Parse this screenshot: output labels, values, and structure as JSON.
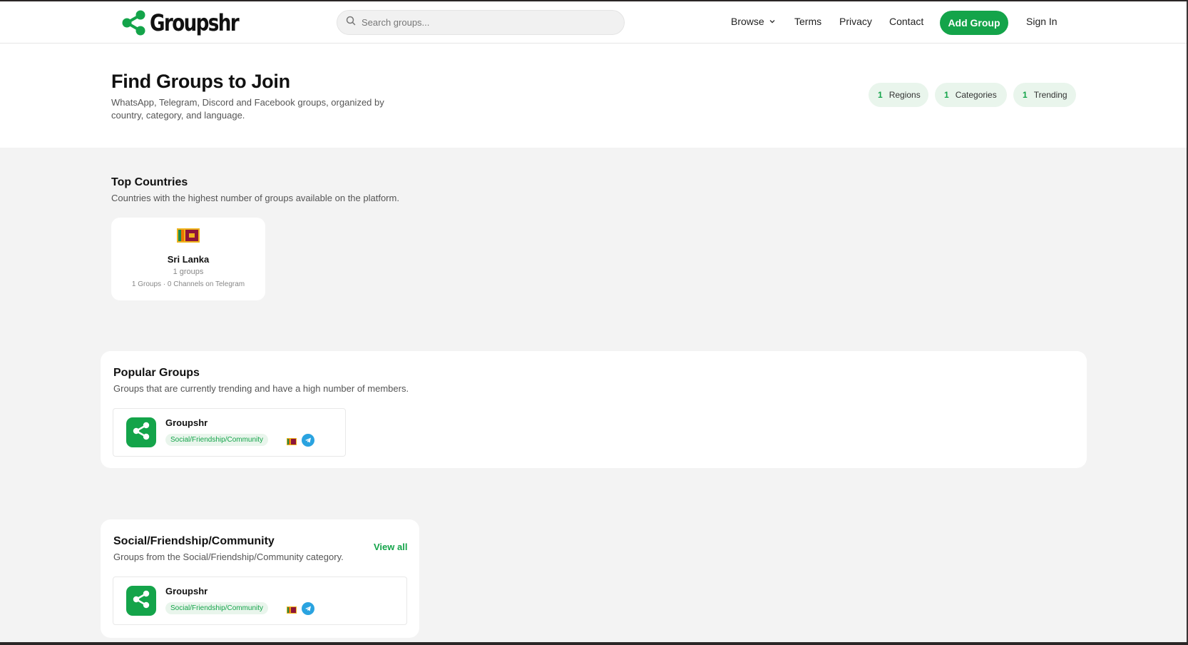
{
  "header": {
    "brand": "Groupshr",
    "search_placeholder": "Search groups...",
    "nav": {
      "browse": "Browse",
      "terms": "Terms",
      "privacy": "Privacy",
      "contact": "Contact",
      "add_group": "Add Group",
      "sign_in": "Sign In"
    }
  },
  "hero": {
    "title": "Find Groups to Join",
    "subtitle": "WhatsApp, Telegram, Discord and Facebook groups, organized by country, category, and language.",
    "stats": [
      {
        "num": "1",
        "label": "Regions"
      },
      {
        "num": "1",
        "label": "Categories"
      },
      {
        "num": "1",
        "label": "Trending"
      }
    ]
  },
  "top_countries": {
    "title": "Top Countries",
    "subtitle": "Countries with the highest number of groups available on the platform.",
    "countries": [
      {
        "name": "Sri Lanka",
        "count": "1 groups",
        "meta": "1 Groups · 0 Channels on Telegram",
        "flag_icon": "sri-lanka-flag-icon"
      }
    ]
  },
  "popular_groups": {
    "title": "Popular Groups",
    "subtitle": "Groups that are currently trending and have a high number of members.",
    "groups": [
      {
        "name": "Groupshr",
        "category": "Social/Friendship/Community",
        "platform_icon": "telegram-icon"
      }
    ]
  },
  "category_section": {
    "title": "Social/Friendship/Community",
    "subtitle": "Groups from the Social/Friendship/Community category.",
    "view_all": "View all",
    "groups": [
      {
        "name": "Groupshr",
        "category": "Social/Friendship/Community",
        "platform_icon": "telegram-icon"
      }
    ]
  },
  "colors": {
    "accent": "#14a44a",
    "accent_light": "#e9f5ec",
    "telegram": "#2aa3e0",
    "page_bg": "#f3f3f3"
  }
}
